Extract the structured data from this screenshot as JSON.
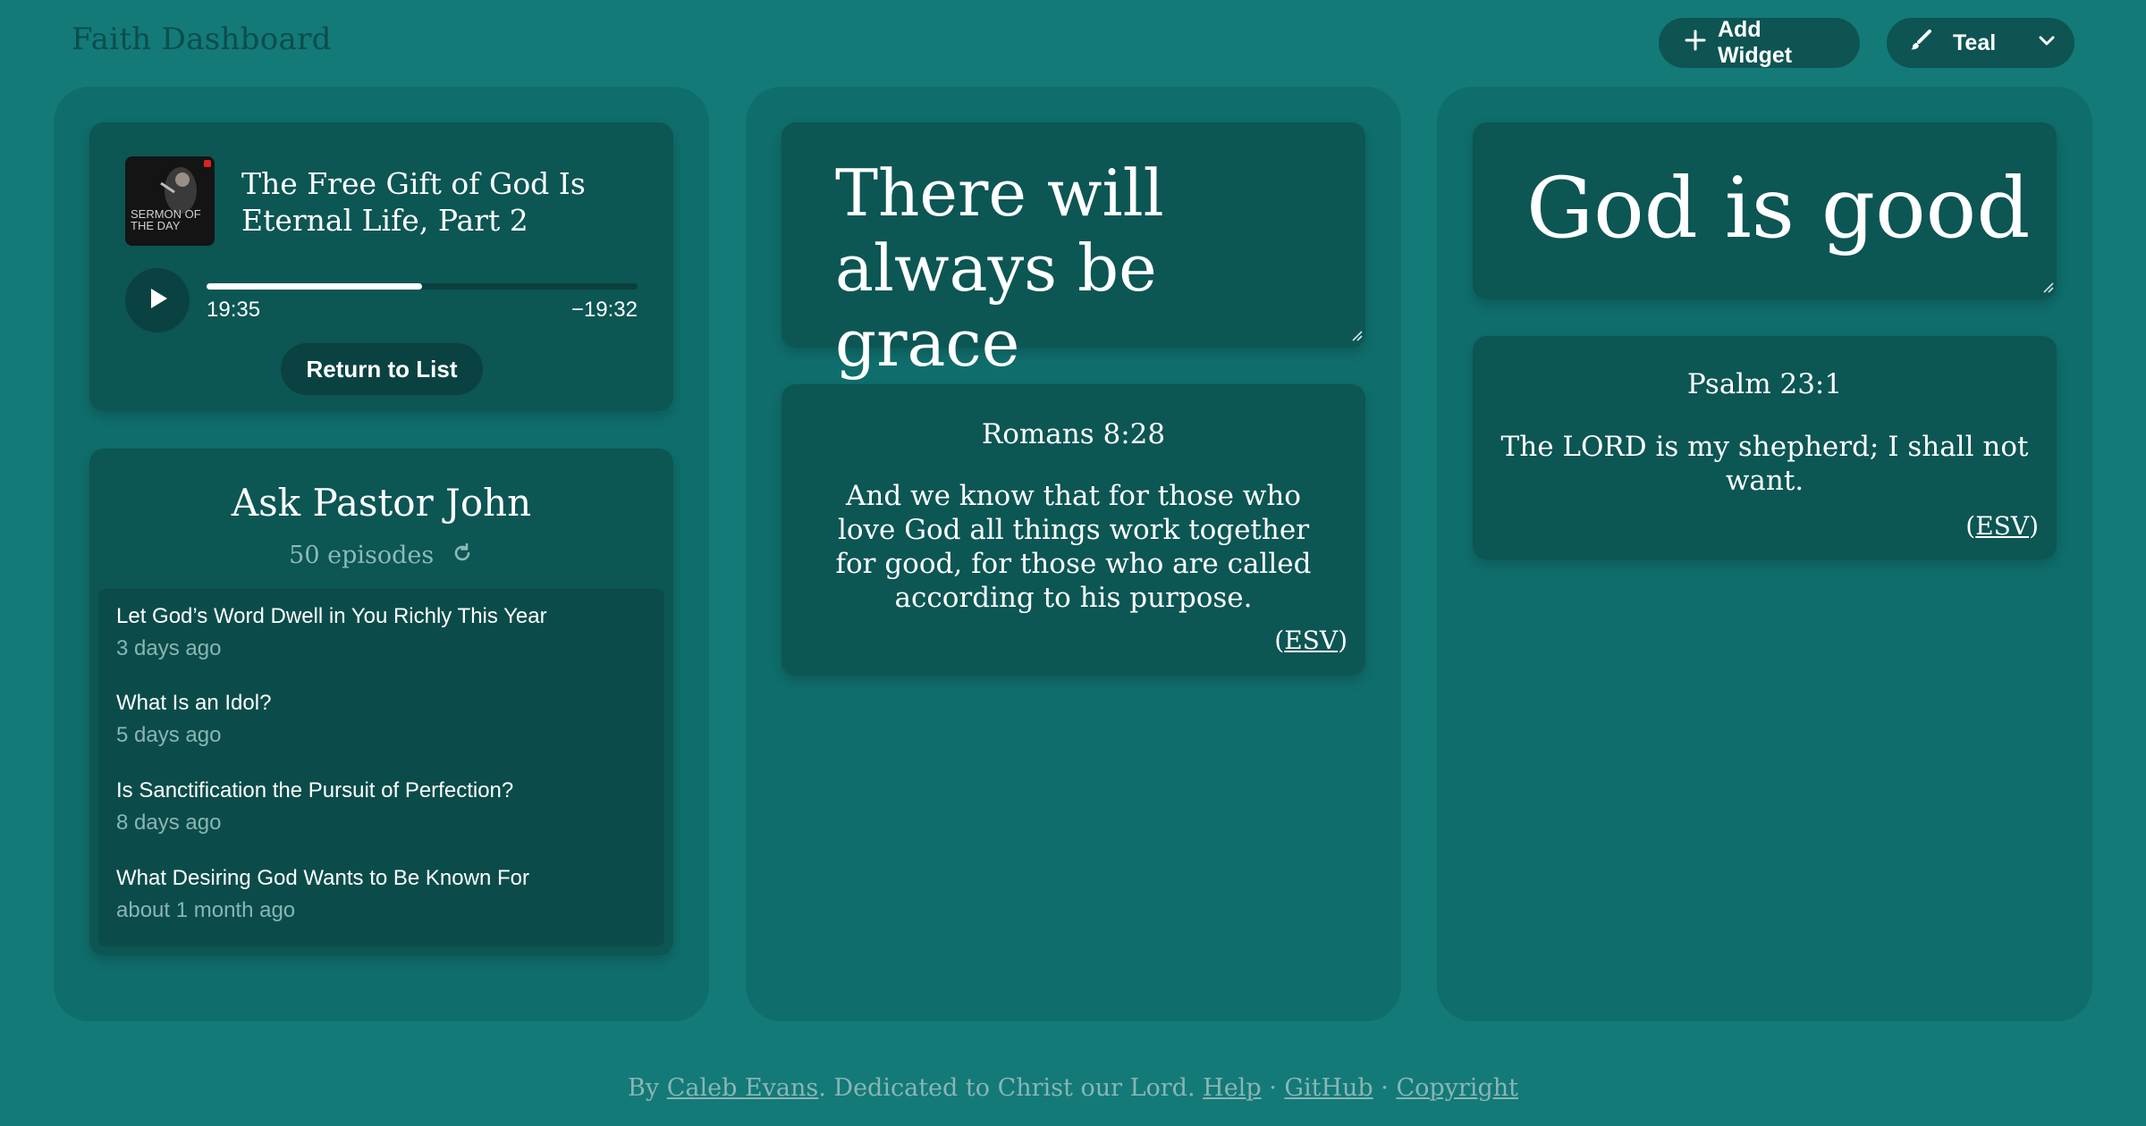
{
  "header": {
    "title": "Faith Dashboard",
    "add_widget_label": "Add Widget",
    "theme_label": "Teal"
  },
  "podcast_player": {
    "episode_title": "The Free Gift of God Is Eternal Life, Part 2",
    "cover_text": "SERMON OF THE DAY",
    "elapsed": "19:35",
    "remaining": "−19:32",
    "progress_fraction": 0.5,
    "return_label": "Return to List"
  },
  "ask_pastor_john": {
    "title": "Ask Pastor John",
    "episode_count": "50 episodes",
    "episodes": [
      {
        "title": "Let God’s Word Dwell in You Richly This Year",
        "date": "3 days ago"
      },
      {
        "title": "What Is an Idol?",
        "date": "5 days ago"
      },
      {
        "title": "Is Sanctification the Pursuit of Perfection?",
        "date": "8 days ago"
      },
      {
        "title": "What Desiring God Wants to Be Known For",
        "date": "about 1 month ago"
      }
    ]
  },
  "notes": {
    "note1": "There will always be grace",
    "note2": "God is good"
  },
  "verses": {
    "verse1": {
      "reference": "Romans 8:28",
      "text": "And we know that for those who love God all things work together for good, for those who are called according to his purpose.",
      "version": "ESV"
    },
    "verse2": {
      "reference": "Psalm 23:1",
      "text": "The LORD is my shepherd; I shall not want.",
      "version": "ESV"
    }
  },
  "footer": {
    "by": "By",
    "author": "Caleb Evans",
    "dedication": ". Dedicated to Christ our Lord.",
    "help": "Help",
    "sep": "·",
    "github": "GitHub",
    "copyright": "Copyright"
  },
  "colors": {
    "background": "#137a78",
    "column": "#0f6e6c",
    "card": "#0c5654"
  },
  "icons": [
    "plus-icon",
    "brush-icon",
    "chevron-down-icon",
    "play-icon",
    "refresh-icon",
    "resize-handle-icon"
  ]
}
